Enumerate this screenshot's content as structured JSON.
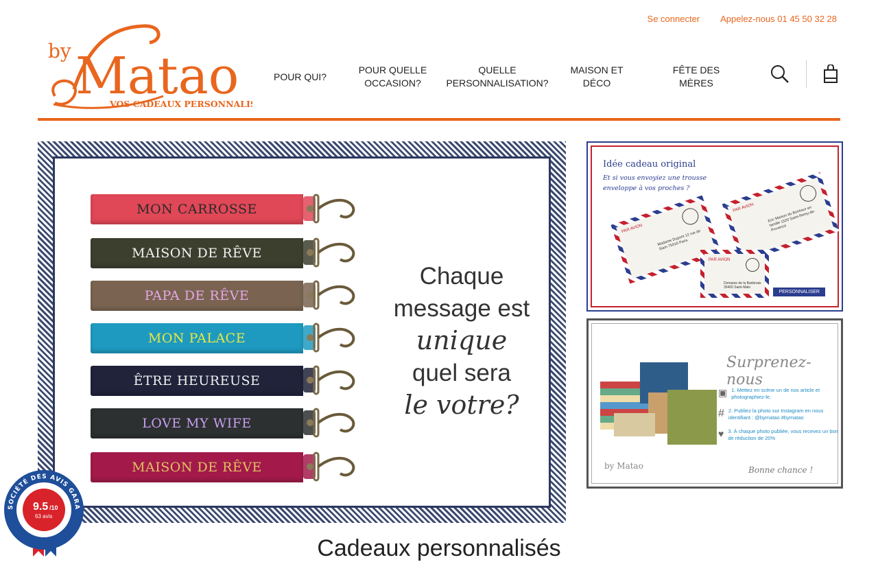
{
  "topbar": {
    "login": "Se connecter",
    "phone": "Appelez-nous 01 45 50 32 28"
  },
  "logo": {
    "by": "by",
    "name": "Matao",
    "tagline": "VOS CADEAUX PERSONNALISÉS"
  },
  "nav": [
    {
      "label": "POUR QUI?"
    },
    {
      "label": "POUR QUELLE OCCASION?"
    },
    {
      "label": "QUELLE PERSONNALISATION?"
    },
    {
      "label": "MAISON ET DÉCO"
    },
    {
      "label": "FÊTE DES MÈRES"
    }
  ],
  "icons": {
    "search": "search-icon",
    "cart": "shopping-bag-icon"
  },
  "hero": {
    "straps": [
      {
        "text": "MON CARROSSE",
        "band": "#e04757",
        "ink": "#2a2a2a"
      },
      {
        "text": "MAISON DE RÊVE",
        "band": "#3c3f2e",
        "ink": "#f2f2f2"
      },
      {
        "text": "PAPA DE RÊVE",
        "band": "#7a6451",
        "ink": "#e4a7e6"
      },
      {
        "text": "MON PALACE",
        "band": "#1e9ac0",
        "ink": "#e8e840"
      },
      {
        "text": "ÊTRE HEUREUSE",
        "band": "#20233a",
        "ink": "#f0f0f0"
      },
      {
        "text": "LOVE MY WIFE",
        "band": "#2d3030",
        "ink": "#c79ef0"
      },
      {
        "text": "MAISON DE RÊVE",
        "band": "#a31a4a",
        "ink": "#e0c060"
      }
    ],
    "msg_line1": "Chaque",
    "msg_line2": "message est",
    "msg_line3": "unique",
    "msg_line4": "quel sera",
    "msg_line5": "le votre?"
  },
  "promo1": {
    "title": "Idée cadeau original",
    "subtitle": "Et si vous envoyiez une trousse enveloppe à vos proches ?",
    "button": "PERSONNALISER",
    "env1_addr": "Madame Dupont 12 rue de Siam 75016 Paris",
    "env2_addr": "Eric Maison du Bonheur en famille 1520 Saint-Remy-de-Provence",
    "env3_addr": "Domaine de la Barbinais 35400 Saint-Malo",
    "stamp_label": "PAR AVION"
  },
  "promo2": {
    "title": "Surprenez-nous",
    "step1": "1. Mettez en scène un de nos article et photographiez-le.",
    "step2": "2. Publiez la photo sur Instagram en nous identifiant : @bymatao #bymatao",
    "step3": "3. À chaque photo publiée, vous recevez un bon de réduction de 20%",
    "signoff": "Bonne chance !",
    "brand": "by Matao"
  },
  "heading": "Cadeaux personnalisés",
  "badge": {
    "ring_text": "SOCIÉTÉ DES AVIS GARANTIS",
    "score": "9.5",
    "scale": "/10",
    "count": "63 avis"
  },
  "colors": {
    "accent": "#e8661e",
    "navy": "#2c3860",
    "badge_red": "#d8232a",
    "badge_blue": "#1f4e9a"
  }
}
